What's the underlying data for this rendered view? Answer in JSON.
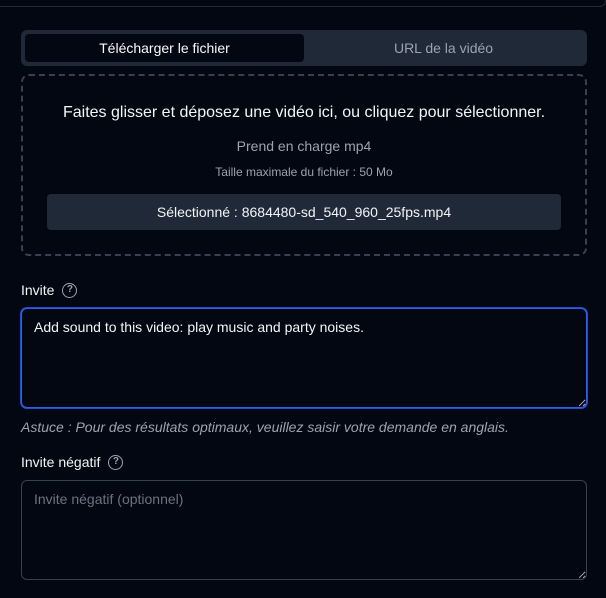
{
  "tabs": [
    {
      "label": "Télécharger le fichier",
      "active": true
    },
    {
      "label": "URL de la vidéo",
      "active": false
    }
  ],
  "dropzone": {
    "instruction": "Faites glisser et déposez une vidéo ici, ou cliquez pour sélectionner.",
    "supported": "Prend en charge mp4",
    "max_size": "Taille maximale du fichier : 50 Mo",
    "selected": "Sélectionné : 8684480-sd_540_960_25fps.mp4"
  },
  "prompt": {
    "label": "Invite",
    "value": "Add sound to this video: play music and party noises.",
    "hint": "Astuce : Pour des résultats optimaux, veuillez saisir votre demande en anglais."
  },
  "negative_prompt": {
    "label": "Invite négatif",
    "value": "",
    "placeholder": "Invite négatif (optionnel)"
  },
  "icons": {
    "help": "question-circle-icon"
  },
  "colors": {
    "background": "#030712",
    "panel": "#1f2937",
    "focus": "#3b5bdb"
  }
}
